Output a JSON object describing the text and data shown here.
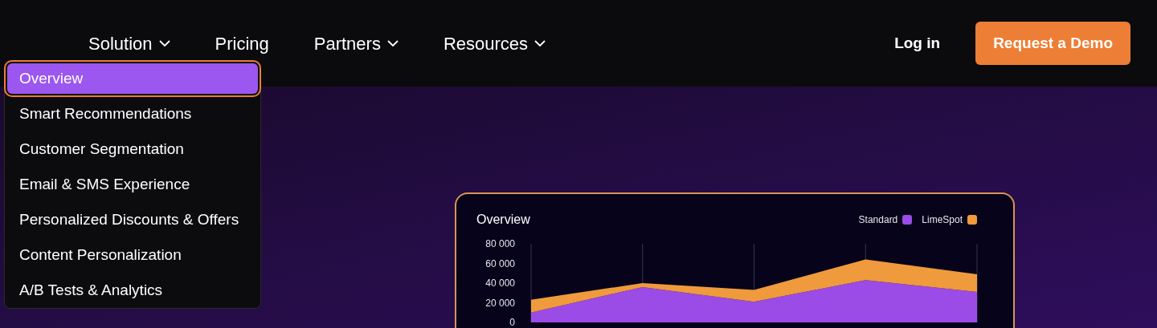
{
  "nav": {
    "items": [
      {
        "label": "Solution",
        "dropdown": true
      },
      {
        "label": "Pricing",
        "dropdown": false
      },
      {
        "label": "Partners",
        "dropdown": true
      },
      {
        "label": "Resources",
        "dropdown": true
      }
    ],
    "login": "Log in",
    "cta": "Request a Demo"
  },
  "menu": {
    "items": [
      {
        "label": "Overview",
        "selected": true
      },
      {
        "label": "Smart Recommendations",
        "selected": false
      },
      {
        "label": "Customer Segmentation",
        "selected": false
      },
      {
        "label": "Email & SMS Experience",
        "selected": false
      },
      {
        "label": "Personalized Discounts & Offers",
        "selected": false
      },
      {
        "label": "Content Personalization",
        "selected": false
      },
      {
        "label": "A/B Tests & Analytics",
        "selected": false
      }
    ]
  },
  "chart_card": {
    "chart_data": {
      "type": "area",
      "title": "Overview",
      "stacked": true,
      "grid": true,
      "series": [
        {
          "name": "Standard",
          "color": "#9b4be6",
          "values": [
            10000,
            36000,
            21000,
            43000,
            31000
          ]
        },
        {
          "name": "LimeSpot",
          "color": "#f09a3e",
          "values": [
            13000,
            4000,
            12000,
            21000,
            18000
          ]
        }
      ],
      "ylim": [
        0,
        80000
      ],
      "yticks": [
        {
          "value": 0,
          "label": "0"
        },
        {
          "value": 20000,
          "label": "20 000"
        },
        {
          "value": 40000,
          "label": "40 000"
        },
        {
          "value": 60000,
          "label": "60 000"
        },
        {
          "value": 80000,
          "label": "80 000"
        }
      ]
    }
  }
}
